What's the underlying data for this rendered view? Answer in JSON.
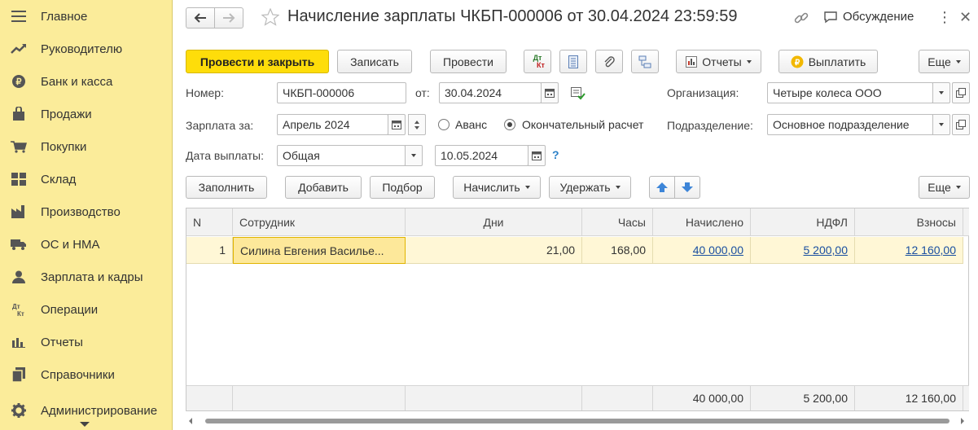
{
  "sidebar": {
    "items": [
      {
        "label": "Главное",
        "icon": "menu-icon"
      },
      {
        "label": "Руководителю",
        "icon": "trend-icon"
      },
      {
        "label": "Банк и касса",
        "icon": "coin-icon"
      },
      {
        "label": "Продажи",
        "icon": "bag-icon"
      },
      {
        "label": "Покупки",
        "icon": "cart-icon"
      },
      {
        "label": "Склад",
        "icon": "warehouse-icon"
      },
      {
        "label": "Производство",
        "icon": "factory-icon"
      },
      {
        "label": "ОС и НМА",
        "icon": "truck-icon"
      },
      {
        "label": "Зарплата и кадры",
        "icon": "person-icon"
      },
      {
        "label": "Операции",
        "icon": "dt-kt-icon"
      },
      {
        "label": "Отчеты",
        "icon": "bar-chart-icon"
      },
      {
        "label": "Справочники",
        "icon": "books-icon"
      },
      {
        "label": "Администрирование",
        "icon": "gear-icon"
      }
    ]
  },
  "header": {
    "title": "Начисление зарплаты ЧКБП-000006 от 30.04.2024 23:59:59",
    "discussion": "Обсуждение"
  },
  "toolbar": {
    "post_close": "Провести и закрыть",
    "save": "Записать",
    "post": "Провести",
    "dtkt_top": "Дт",
    "dtkt_bottom": "Кт",
    "reports": "Отчеты",
    "pay": "Выплатить",
    "more": "Еще"
  },
  "form": {
    "number_label": "Номер:",
    "number_value": "ЧКБП-000006",
    "from_label": "от:",
    "date_value": "30.04.2024",
    "org_label": "Организация:",
    "org_value": "Четыре колеса ООО",
    "salary_for_label": "Зарплата за:",
    "salary_for_value": "Апрель 2024",
    "advance_label": "Аванс",
    "final_label": "Окончательный расчет",
    "dept_label": "Подразделение:",
    "dept_value": "Основное подразделение",
    "pay_date_label": "Дата выплаты:",
    "pay_date_type": "Общая",
    "pay_date_value": "10.05.2024",
    "help": "?"
  },
  "table_toolbar": {
    "fill": "Заполнить",
    "add": "Добавить",
    "pick": "Подбор",
    "accrue": "Начислить",
    "withhold": "Удержать",
    "more": "Еще"
  },
  "table": {
    "columns": [
      "N",
      "Сотрудник",
      "Дни",
      "Часы",
      "Начислено",
      "НДФЛ",
      "Взносы"
    ],
    "rows": [
      {
        "n": "1",
        "employee": "Силина Евгения Василье...",
        "days": "21,00",
        "hours": "168,00",
        "accrued": "40 000,00",
        "ndfl": "5 200,00",
        "contrib": "12 160,00"
      }
    ],
    "totals": {
      "accrued": "40 000,00",
      "ndfl": "5 200,00",
      "contrib": "12 160,00"
    }
  },
  "colors": {
    "sidebar_bg": "#fbec9a",
    "primary_button": "#fedd0a",
    "selected_row": "#fff7d6",
    "link": "#1a4fa0"
  }
}
